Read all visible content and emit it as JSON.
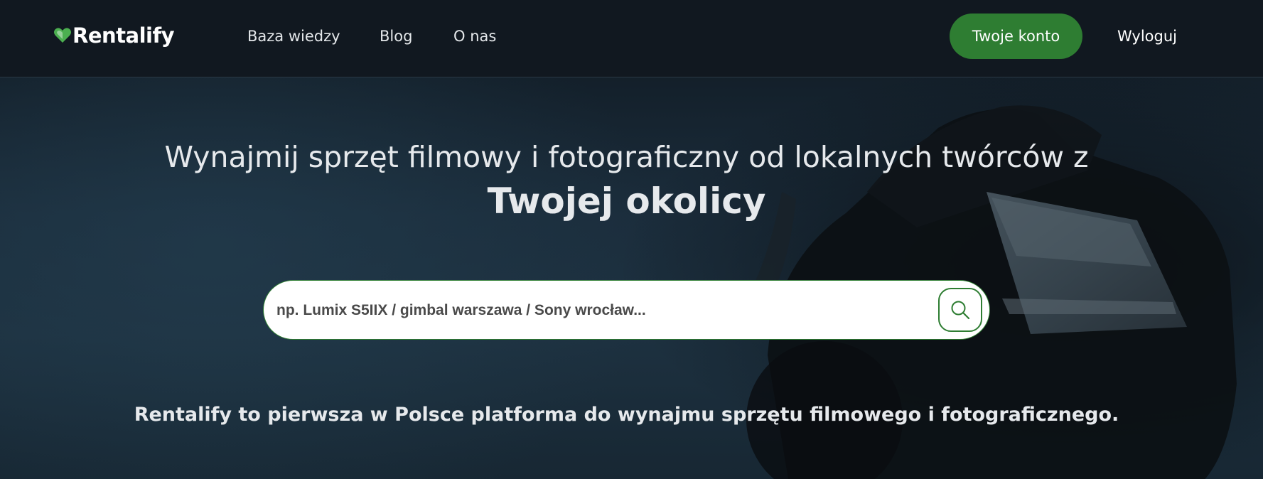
{
  "brand": {
    "name": "Rentalify",
    "logo_icon": "heart-icon",
    "accent_color": "#2e7d32"
  },
  "nav": {
    "items": [
      {
        "label": "Baza wiedzy"
      },
      {
        "label": "Blog"
      },
      {
        "label": "O nas"
      }
    ],
    "account_button": "Twoje konto",
    "logout": "Wyloguj"
  },
  "hero": {
    "headline": "Wynajmij sprzęt filmowy i fotograficzny od lokalnych twórców z",
    "headline_emphasis": "Twojej okolicy"
  },
  "search": {
    "placeholder": "np. Lumix S5IIX / gimbal warszawa / Sony wrocław...",
    "value": "",
    "button_icon": "search-icon"
  },
  "tagline": "Rentalify to pierwsza w Polsce platforma do wynajmu sprzętu filmowego i fotograficznego."
}
